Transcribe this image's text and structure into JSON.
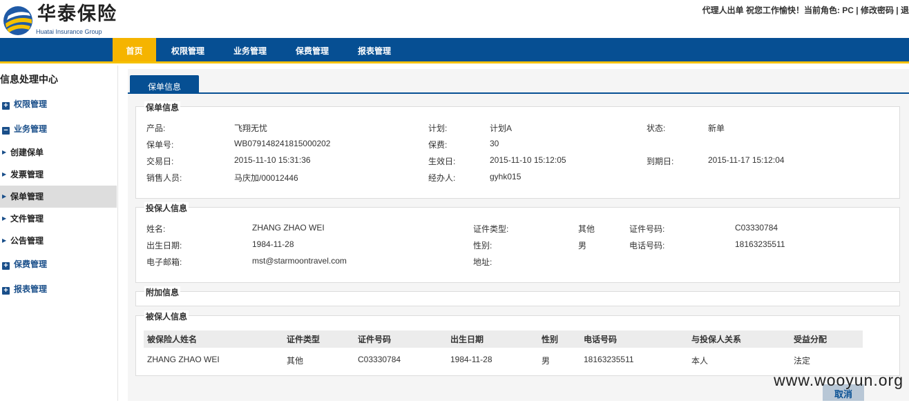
{
  "header": {
    "logo_cn": "华泰保险",
    "logo_en": "Huatai Insurance Group",
    "user_info": "代理人出单 祝您工作愉快！当前角色: PC | 修改密码 | 退"
  },
  "nav": {
    "items": [
      {
        "label": "首页"
      },
      {
        "label": "权限管理"
      },
      {
        "label": "业务管理"
      },
      {
        "label": "保费管理"
      },
      {
        "label": "报表管理"
      }
    ]
  },
  "sidebar": {
    "title": "信息处理中心",
    "groups": {
      "perm": {
        "label": "权限管理",
        "icon": "+"
      },
      "biz": {
        "label": "业务管理",
        "icon": "−"
      },
      "premium": {
        "label": "保费管理",
        "icon": "+"
      },
      "report": {
        "label": "报表管理",
        "icon": "+"
      }
    },
    "items": [
      {
        "label": "创建保单"
      },
      {
        "label": "发票管理"
      },
      {
        "label": "保单管理"
      },
      {
        "label": "文件管理"
      },
      {
        "label": "公告管理"
      }
    ]
  },
  "tab": {
    "label": "保单信息"
  },
  "policy": {
    "title": "保单信息",
    "product_label": "产品:",
    "product": "飞翔无忧",
    "plan_label": "计划:",
    "plan": "计划A",
    "status_label": "状态:",
    "status": "新单",
    "policy_no_label": "保单号:",
    "policy_no": "WB079148241815000202",
    "premium_label": "保费:",
    "premium": "30",
    "trade_date_label": "交易日:",
    "trade_date": "2015-11-10 15:31:36",
    "effective_label": "生效日:",
    "effective": "2015-11-10 15:12:05",
    "expiry_label": "到期日:",
    "expiry": "2015-11-17 15:12:04",
    "sales_label": "销售人员:",
    "sales": "马庆加/00012446",
    "handler_label": "经办人:",
    "handler": "gyhk015"
  },
  "applicant": {
    "title": "投保人信息",
    "name_label": "姓名:",
    "name": "ZHANG ZHAO WEI",
    "id_type_label": "证件类型:",
    "id_type": "其他",
    "id_no_label": "证件号码:",
    "id_no": "C03330784",
    "birth_label": "出生日期:",
    "birth": "1984-11-28",
    "gender_label": "性别:",
    "gender": "男",
    "phone_label": "电话号码:",
    "phone": "18163235511",
    "email_label": "电子邮箱:",
    "email": "mst@starmoontravel.com",
    "address_label": "地址:"
  },
  "extra": {
    "title": "附加信息"
  },
  "insured": {
    "title": "被保人信息",
    "columns": [
      "被保险人姓名",
      "证件类型",
      "证件号码",
      "出生日期",
      "性别",
      "电话号码",
      "与投保人关系",
      "受益分配"
    ],
    "rows": [
      [
        "ZHANG ZHAO WEI",
        "其他",
        "C03330784",
        "1984-11-28",
        "男",
        "18163235511",
        "本人",
        "法定"
      ]
    ]
  },
  "footer": {
    "cancel_label": "取消",
    "watermark": "www.wooyun.org"
  },
  "colors": {
    "nav_bg": "#064f93",
    "nav_active": "#f5b400",
    "accent_line": "#f5c100",
    "sidebar_text": "#1a4f8a"
  }
}
